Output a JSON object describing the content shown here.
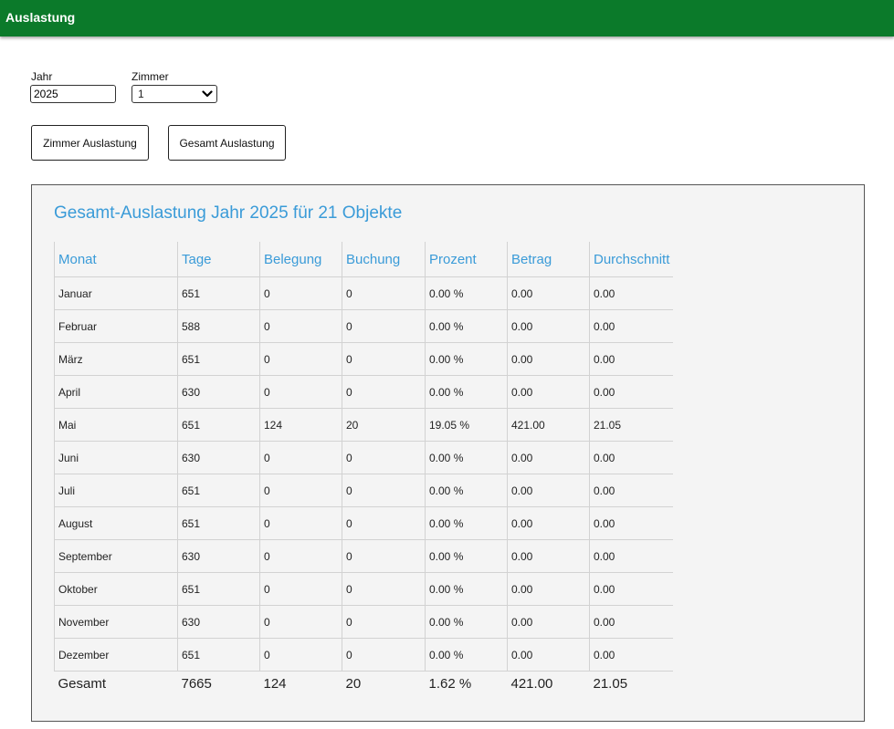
{
  "header": {
    "title": "Auslastung",
    "color": "#0b7a2a"
  },
  "form": {
    "year_label": "Jahr",
    "year_value": "2025",
    "room_label": "Zimmer",
    "room_value": "1"
  },
  "buttons": {
    "room_utilization": "Zimmer Auslastung",
    "total_utilization": "Gesamt Auslastung"
  },
  "report": {
    "title": "Gesamt-Auslastung Jahr 2025 für 21 Objekte",
    "accent_color": "#3a9bd8",
    "columns": [
      "Monat",
      "Tage",
      "Belegung",
      "Buchung",
      "Prozent",
      "Betrag",
      "Durchschnitt"
    ],
    "rows": [
      [
        "Januar",
        "651",
        "0",
        "0",
        "0.00 %",
        "0.00",
        "0.00"
      ],
      [
        "Februar",
        "588",
        "0",
        "0",
        "0.00 %",
        "0.00",
        "0.00"
      ],
      [
        "März",
        "651",
        "0",
        "0",
        "0.00 %",
        "0.00",
        "0.00"
      ],
      [
        "April",
        "630",
        "0",
        "0",
        "0.00 %",
        "0.00",
        "0.00"
      ],
      [
        "Mai",
        "651",
        "124",
        "20",
        "19.05 %",
        "421.00",
        "21.05"
      ],
      [
        "Juni",
        "630",
        "0",
        "0",
        "0.00 %",
        "0.00",
        "0.00"
      ],
      [
        "Juli",
        "651",
        "0",
        "0",
        "0.00 %",
        "0.00",
        "0.00"
      ],
      [
        "August",
        "651",
        "0",
        "0",
        "0.00 %",
        "0.00",
        "0.00"
      ],
      [
        "September",
        "630",
        "0",
        "0",
        "0.00 %",
        "0.00",
        "0.00"
      ],
      [
        "Oktober",
        "651",
        "0",
        "0",
        "0.00 %",
        "0.00",
        "0.00"
      ],
      [
        "November",
        "630",
        "0",
        "0",
        "0.00 %",
        "0.00",
        "0.00"
      ],
      [
        "Dezember",
        "651",
        "0",
        "0",
        "0.00 %",
        "0.00",
        "0.00"
      ]
    ],
    "total": [
      "Gesamt",
      "7665",
      "124",
      "20",
      "1.62 %",
      "421.00",
      "21.05"
    ]
  }
}
